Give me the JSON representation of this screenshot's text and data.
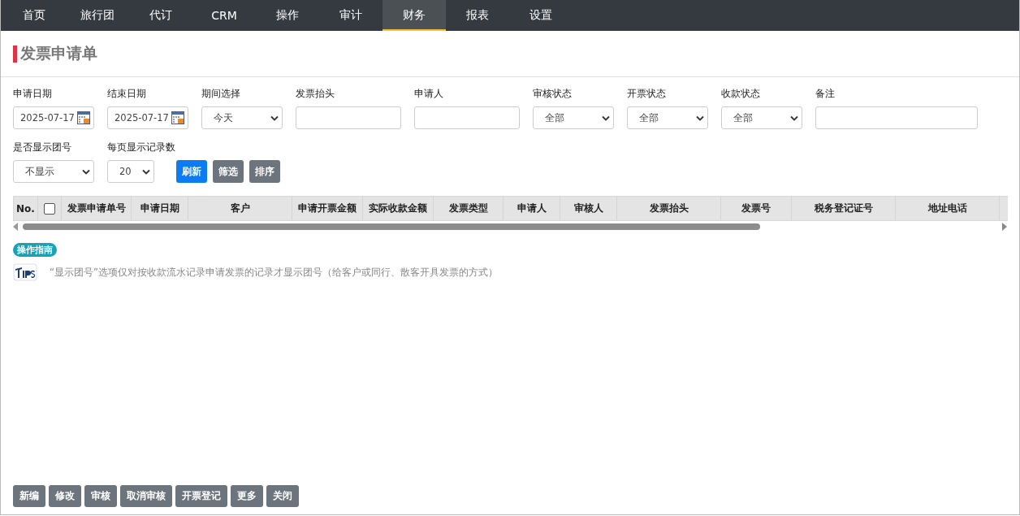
{
  "nav": [
    {
      "label": "首页",
      "selected": false
    },
    {
      "label": "旅行团",
      "selected": false
    },
    {
      "label": "代订",
      "selected": false
    },
    {
      "label": "CRM",
      "selected": false
    },
    {
      "label": "操作",
      "selected": false
    },
    {
      "label": "审计",
      "selected": false
    },
    {
      "label": "财务",
      "selected": true
    },
    {
      "label": "报表",
      "selected": false
    },
    {
      "label": "设置",
      "selected": false
    }
  ],
  "page_title": "发票申请单",
  "filter_rows": [
    [
      {
        "label": "申请日期",
        "kind": "date",
        "value": "2025-07-17"
      },
      {
        "label": "结束日期",
        "kind": "date",
        "value": "2025-07-17"
      },
      {
        "label": "期间选择",
        "kind": "select",
        "value": "今天"
      },
      {
        "label": "发票抬头",
        "kind": "text"
      },
      {
        "label": "申请人",
        "kind": "text"
      },
      {
        "label": "审核状态",
        "kind": "select",
        "value": "全部"
      },
      {
        "label": "开票状态",
        "kind": "select",
        "value": "全部"
      },
      {
        "label": "收款状态",
        "kind": "select",
        "value": "全部"
      },
      {
        "label": "备注",
        "kind": "wide"
      }
    ],
    [
      {
        "label": "是否显示团号",
        "kind": "select",
        "value": "不显示"
      },
      {
        "label": "每页显示记录数",
        "kind": "small",
        "value": "20"
      }
    ]
  ],
  "filter_buttons": [
    {
      "label": "刷新",
      "kind": "primary"
    },
    {
      "label": "筛选",
      "kind": "secondary"
    },
    {
      "label": "排序",
      "kind": "secondary"
    }
  ],
  "table": {
    "select_all_checked": false,
    "columns": [
      "No.",
      "",
      "发票申请单号",
      "申请日期",
      "客户",
      "申请开票金额",
      "实际收款金额",
      "发票类型",
      "申请人",
      "审核人",
      "发票抬头",
      "发票号",
      "税务登记证号",
      "地址电话"
    ]
  },
  "guide_badge": "操作指南",
  "tip": "“显示团号”选项仅对按收款流水记录申请发票的记录才显示团号（给客户或同行、散客开具发票的方式）",
  "bottom_buttons": [
    "新编",
    "修改",
    "审核",
    "取消审核",
    "开票登记",
    "更多",
    "关闭"
  ]
}
